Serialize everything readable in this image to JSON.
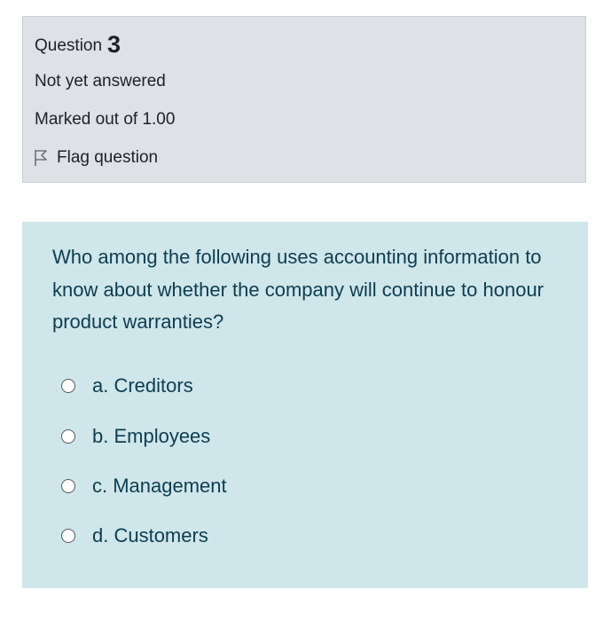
{
  "info": {
    "question_word": "Question",
    "question_number": "3",
    "state": "Not yet answered",
    "grade": "Marked out of 1.00",
    "flag_label": "Flag question"
  },
  "question": {
    "text": "Who among the following uses accounting information to know about whether the company will continue to honour product warranties?",
    "options": [
      {
        "label": "a. Creditors",
        "selected": false
      },
      {
        "label": "b. Employees",
        "selected": false
      },
      {
        "label": "c. Management",
        "selected": false
      },
      {
        "label": "d. Customers",
        "selected": false
      }
    ]
  },
  "colors": {
    "info_background": "#dee2e6",
    "question_background": "#cfe6ea",
    "question_text": "#0d3d50"
  },
  "icons": {
    "flag": "flag-icon",
    "radio": "radio-unchecked-icon"
  }
}
